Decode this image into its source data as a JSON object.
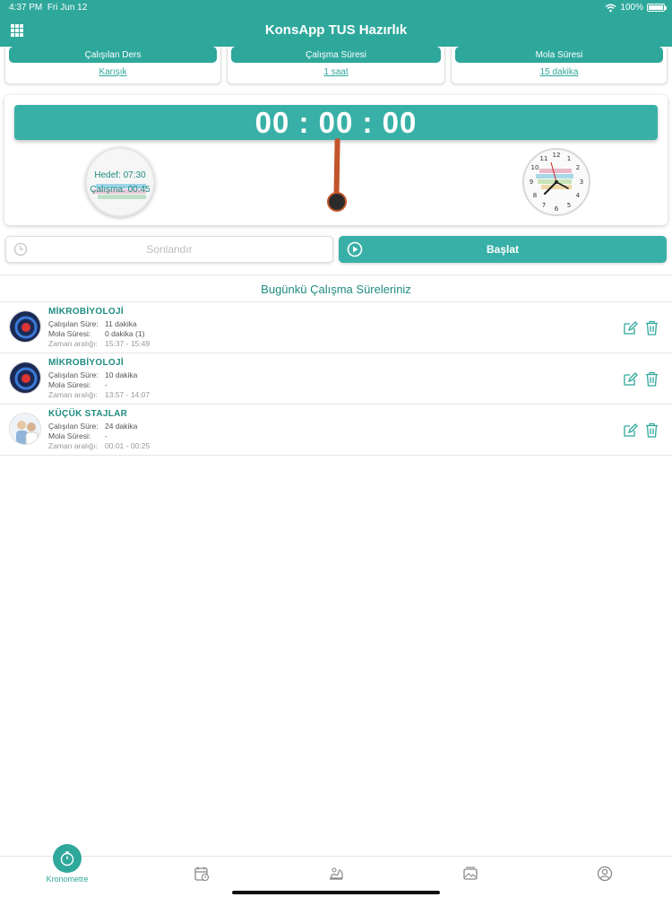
{
  "status": {
    "time": "4:37 PM",
    "date": "Fri Jun 12",
    "battery": "100%"
  },
  "header": {
    "title": "KonsApp TUS Hazırlık"
  },
  "info": {
    "lesson_label": "Çalışılan Ders",
    "lesson_value": "Karışık",
    "duration_label": "Çalışma Süresi",
    "duration_value": "1 saat",
    "break_label": "Mola Süresi",
    "break_value": "15 dakika"
  },
  "timer": {
    "display": "00 : 00 : 00",
    "goal_target": "Hedef: 07:30",
    "goal_work": "Çalışma: 00:45"
  },
  "buttons": {
    "finish": "Sonlandır",
    "start": "Başlat"
  },
  "section": {
    "title": "Bugünkü Çalışma Süreleriniz"
  },
  "labels": {
    "studied": "Çalışılan Süre:",
    "break": "Mola Süresi:",
    "range": "Zaman aralığı:"
  },
  "sessions": [
    {
      "title": "MİKROBİYOLOJİ",
      "studied": "11 dakika",
      "break": "0 dakika (1)",
      "range": "15:37 - 15:49"
    },
    {
      "title": "MİKROBİYOLOJİ",
      "studied": "10 dakika",
      "break": "-",
      "range": "13:57 - 14:07"
    },
    {
      "title": "KÜÇÜK STAJLAR",
      "studied": "24 dakika",
      "break": "-",
      "range": "00:01 - 00:25"
    }
  ],
  "tabbar": {
    "active_label": "Kronometre"
  },
  "colors": {
    "accent": "#2fa89c",
    "pendulum": "#c2552a"
  },
  "icons": [
    "menu-grid-icon",
    "clock-icon",
    "play-icon",
    "edit-icon",
    "trash-icon",
    "stopwatch-icon",
    "calendar-icon",
    "stats-icon",
    "photo-icon",
    "profile-icon"
  ]
}
